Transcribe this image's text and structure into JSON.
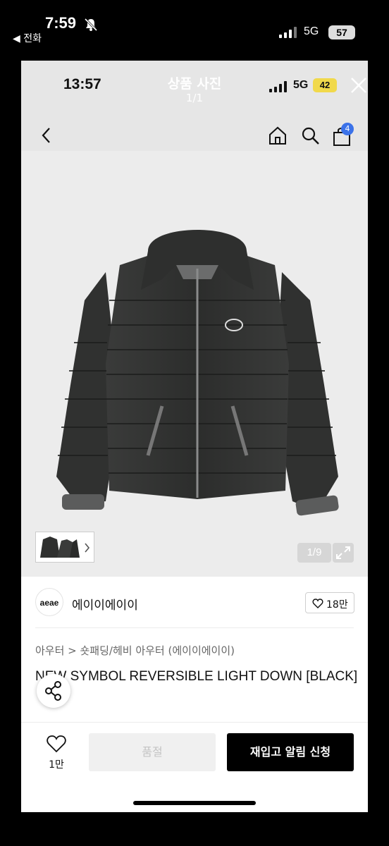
{
  "outer_status": {
    "time": "7:59",
    "back_label": "◀ 전화",
    "network": "5G",
    "battery": "57"
  },
  "viewer": {
    "inner_time": "13:57",
    "title": "상품 사진",
    "count": "1/1",
    "inner_network": "5G",
    "inner_battery": "42",
    "cart_count": "4"
  },
  "gallery": {
    "page_indicator": "1/9"
  },
  "brand": {
    "logo_text": "aeae",
    "name": "에이이에이이",
    "likes": "18만"
  },
  "product": {
    "breadcrumb": "아우터 > 숏패딩/헤비 아우터 (에이이에이이)",
    "title": "NEW SYMBOL REVERSIBLE LIGHT DOWN [BLACK]"
  },
  "bottom_bar": {
    "likes": "1만",
    "soldout_label": "품절",
    "restock_label": "재입고 알림 신청"
  }
}
